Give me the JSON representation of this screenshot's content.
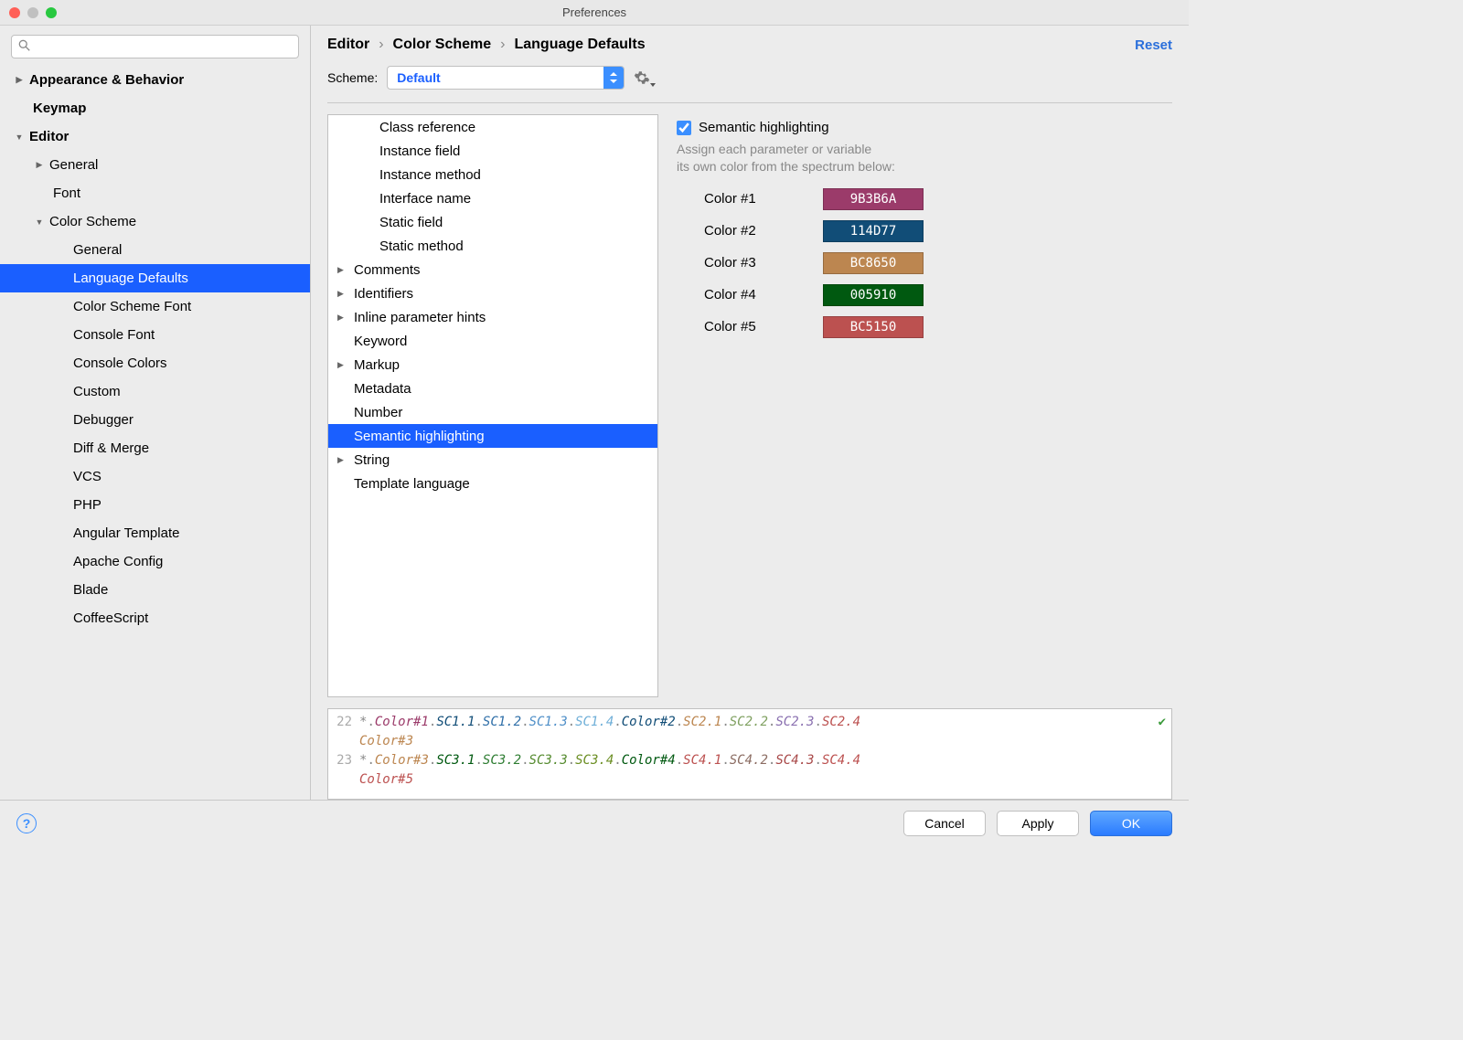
{
  "window": {
    "title": "Preferences"
  },
  "sidebar": {
    "search_placeholder": "",
    "items": [
      {
        "label": "Appearance & Behavior",
        "level": 1,
        "disclosure": "right"
      },
      {
        "label": "Keymap",
        "level": 1,
        "disclosure": "none"
      },
      {
        "label": "Editor",
        "level": 1,
        "disclosure": "down"
      },
      {
        "label": "General",
        "level": 2,
        "disclosure": "right"
      },
      {
        "label": "Font",
        "level": 2,
        "disclosure": "none"
      },
      {
        "label": "Color Scheme",
        "level": 2,
        "disclosure": "down"
      },
      {
        "label": "General",
        "level": 3,
        "disclosure": "none"
      },
      {
        "label": "Language Defaults",
        "level": 3,
        "disclosure": "none",
        "selected": true
      },
      {
        "label": "Color Scheme Font",
        "level": 3,
        "disclosure": "none"
      },
      {
        "label": "Console Font",
        "level": 3,
        "disclosure": "none"
      },
      {
        "label": "Console Colors",
        "level": 3,
        "disclosure": "none"
      },
      {
        "label": "Custom",
        "level": 3,
        "disclosure": "none"
      },
      {
        "label": "Debugger",
        "level": 3,
        "disclosure": "none"
      },
      {
        "label": "Diff & Merge",
        "level": 3,
        "disclosure": "none"
      },
      {
        "label": "VCS",
        "level": 3,
        "disclosure": "none"
      },
      {
        "label": "PHP",
        "level": 3,
        "disclosure": "none"
      },
      {
        "label": "Angular Template",
        "level": 3,
        "disclosure": "none"
      },
      {
        "label": "Apache Config",
        "level": 3,
        "disclosure": "none"
      },
      {
        "label": "Blade",
        "level": 3,
        "disclosure": "none"
      },
      {
        "label": "CoffeeScript",
        "level": 3,
        "disclosure": "none"
      }
    ]
  },
  "breadcrumb": {
    "seg0": "Editor",
    "seg1": "Color Scheme",
    "seg2": "Language Defaults",
    "sep": "›"
  },
  "reset_label": "Reset",
  "scheme": {
    "label": "Scheme:",
    "value": "Default"
  },
  "attrs": [
    {
      "label": "Class reference",
      "indent": 1
    },
    {
      "label": "Instance field",
      "indent": 1
    },
    {
      "label": "Instance method",
      "indent": 1
    },
    {
      "label": "Interface name",
      "indent": 1
    },
    {
      "label": "Static field",
      "indent": 1
    },
    {
      "label": "Static method",
      "indent": 1
    },
    {
      "label": "Comments",
      "indent": 0,
      "disclosure": "right"
    },
    {
      "label": "Identifiers",
      "indent": 0,
      "disclosure": "right"
    },
    {
      "label": "Inline parameter hints",
      "indent": 0,
      "disclosure": "right"
    },
    {
      "label": "Keyword",
      "indent": 0
    },
    {
      "label": "Markup",
      "indent": 0,
      "disclosure": "right"
    },
    {
      "label": "Metadata",
      "indent": 0
    },
    {
      "label": "Number",
      "indent": 0
    },
    {
      "label": "Semantic highlighting",
      "indent": 0,
      "selected": true
    },
    {
      "label": "String",
      "indent": 0,
      "disclosure": "right"
    },
    {
      "label": "Template language",
      "indent": 0
    }
  ],
  "right": {
    "check_label": "Semantic highlighting",
    "desc_l1": "Assign each parameter or variable",
    "desc_l2": "its own color from the spectrum below:",
    "colors": [
      {
        "label": "Color #1",
        "hex": "9B3B6A",
        "bg": "#9B3B6A",
        "fg": "#ffffff"
      },
      {
        "label": "Color #2",
        "hex": "114D77",
        "bg": "#114D77",
        "fg": "#ffffff"
      },
      {
        "label": "Color #3",
        "hex": "BC8650",
        "bg": "#BC8650",
        "fg": "#ffffff"
      },
      {
        "label": "Color #4",
        "hex": "005910",
        "bg": "#005910",
        "fg": "#ffffff"
      },
      {
        "label": "Color #5",
        "hex": "BC5150",
        "bg": "#BC5150",
        "fg": "#ffffff"
      }
    ]
  },
  "preview": {
    "lines": [
      {
        "num": "22",
        "tokens": [
          {
            "t": "*",
            "c": "#888888"
          },
          {
            "t": "Color#1",
            "c": "#9B3B6A"
          },
          {
            "t": "SC1.1",
            "c": "#114D77"
          },
          {
            "t": "SC1.2",
            "c": "#2F6FA8"
          },
          {
            "t": "SC1.3",
            "c": "#4F8FC8"
          },
          {
            "t": "SC1.4",
            "c": "#6FAFD8"
          },
          {
            "t": "Color#2",
            "c": "#114D77"
          },
          {
            "t": "SC2.1",
            "c": "#BC8650"
          },
          {
            "t": "SC2.2",
            "c": "#7FA060"
          },
          {
            "t": "SC2.3",
            "c": "#8A70B0"
          },
          {
            "t": "SC2.4",
            "c": "#BC5150"
          },
          {
            "t": "Color#3",
            "c": "#BC8650",
            "wrap": true
          }
        ]
      },
      {
        "num": "23",
        "tokens": [
          {
            "t": "*",
            "c": "#888888"
          },
          {
            "t": "Color#3",
            "c": "#BC8650"
          },
          {
            "t": "SC3.1",
            "c": "#005910"
          },
          {
            "t": "SC3.2",
            "c": "#2E7D32"
          },
          {
            "t": "SC3.3",
            "c": "#558B2F"
          },
          {
            "t": "SC3.4",
            "c": "#6B8E23"
          },
          {
            "t": "Color#4",
            "c": "#005910"
          },
          {
            "t": "SC4.1",
            "c": "#BC5150"
          },
          {
            "t": "SC4.2",
            "c": "#8B6C62"
          },
          {
            "t": "SC4.3",
            "c": "#A84848"
          },
          {
            "t": "SC4.4",
            "c": "#BC5150"
          },
          {
            "t": "Color#5",
            "c": "#BC5150",
            "wrap": true
          }
        ]
      }
    ]
  },
  "footer": {
    "cancel": "Cancel",
    "apply": "Apply",
    "ok": "OK"
  }
}
